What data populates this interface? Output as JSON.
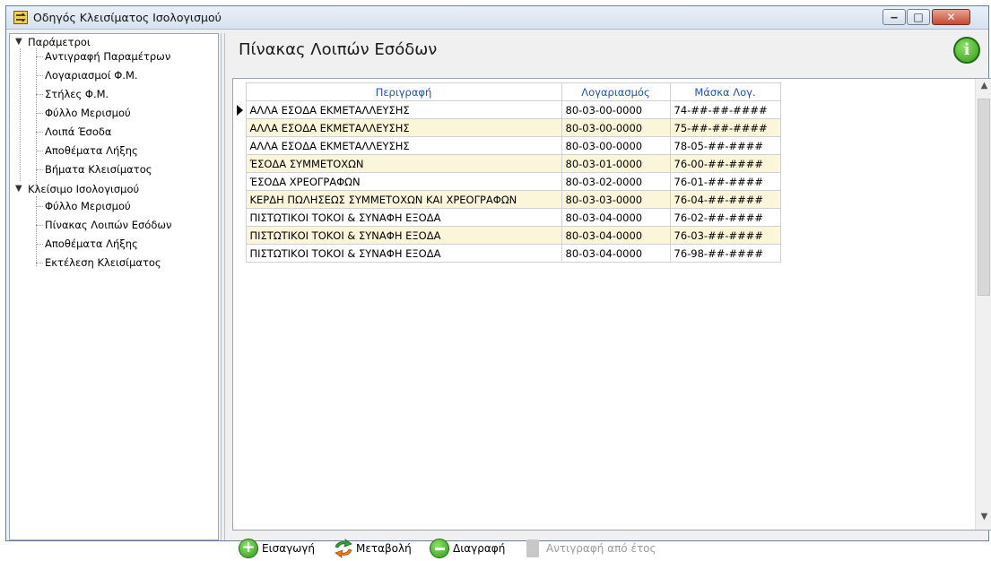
{
  "window": {
    "title": "Οδηγός Κλεισίματος Ισολογισμού",
    "min_glyph": "‒",
    "max_glyph": "□",
    "close_glyph": "✕"
  },
  "tree": {
    "groups": [
      {
        "label": "Παράμετροι",
        "children": [
          "Αντιγραφή Παραμέτρων",
          "Λογαριασμοί Φ.Μ.",
          "Στήλες Φ.Μ.",
          "Φύλλο Μερισμού",
          "Λοιπά Έσοδα",
          "Αποθέματα Λήξης",
          "Βήματα Κλεισίματος"
        ]
      },
      {
        "label": "Κλείσιμο Ισολογισμού",
        "children": [
          "Φύλλο Μερισμού",
          "Πίνακας Λοιπών Εσόδων",
          "Αποθέματα Λήξης",
          "Εκτέλεση Κλεισίματος"
        ]
      }
    ]
  },
  "main": {
    "title": "Πίνακας Λοιπών Εσόδων",
    "info_glyph": "i"
  },
  "grid": {
    "columns": [
      "Περιγραφή",
      "Λογαριασμός",
      "Μάσκα Λογ."
    ],
    "rows": [
      [
        "ΑΛΛΑ ΕΣΟΔΑ ΕΚΜΕΤΑΛΛΕΥΣΗΣ",
        "80-03-00-0000",
        "74-##-##-####"
      ],
      [
        "ΑΛΛΑ ΕΣΟΔΑ ΕΚΜΕΤΑΛΛΕΥΣΗΣ",
        "80-03-00-0000",
        "75-##-##-####"
      ],
      [
        "ΑΛΛΑ ΕΣΟΔΑ ΕΚΜΕΤΑΛΛΕΥΣΗΣ",
        "80-03-00-0000",
        "78-05-##-####"
      ],
      [
        "ΈΣΟΔΑ ΣΥΜΜΕΤΟΧΩΝ",
        "80-03-01-0000",
        "76-00-##-####"
      ],
      [
        "ΈΣΟΔΑ ΧΡΕΟΓΡΑΦΩΝ",
        "80-03-02-0000",
        "76-01-##-####"
      ],
      [
        "ΚΕΡΔΗ ΠΩΛΗΣΕΩΣ ΣΥΜΜΕΤΟΧΩΝ ΚΑΙ ΧΡΕΟΓΡΑΦΩΝ",
        "80-03-03-0000",
        "76-04-##-####"
      ],
      [
        "ΠΙΣΤΩΤΙΚΟΙ ΤΟΚΟΙ & ΣΥΝΑΦΗ ΕΞΟΔΑ",
        "80-03-04-0000",
        "76-02-##-####"
      ],
      [
        "ΠΙΣΤΩΤΙΚΟΙ ΤΟΚΟΙ & ΣΥΝΑΦΗ ΕΞΟΔΑ",
        "80-03-04-0000",
        "76-03-##-####"
      ],
      [
        "ΠΙΣΤΩΤΙΚΟΙ ΤΟΚΟΙ & ΣΥΝΑΦΗ ΕΞΟΔΑ",
        "80-03-04-0000",
        "76-98-##-####"
      ]
    ],
    "scroll_up_glyph": "▲",
    "scroll_down_glyph": "▼"
  },
  "toolbar": {
    "add_label": "Εισαγωγή",
    "edit_label": "Μεταβολή",
    "delete_label": "Διαγραφή",
    "copy_label": "Αντιγραφή από έτος"
  },
  "colors": {
    "header_text": "#1c4fc4",
    "alt_row": "#fbf6d9",
    "accent_green": "#2f9a17"
  }
}
